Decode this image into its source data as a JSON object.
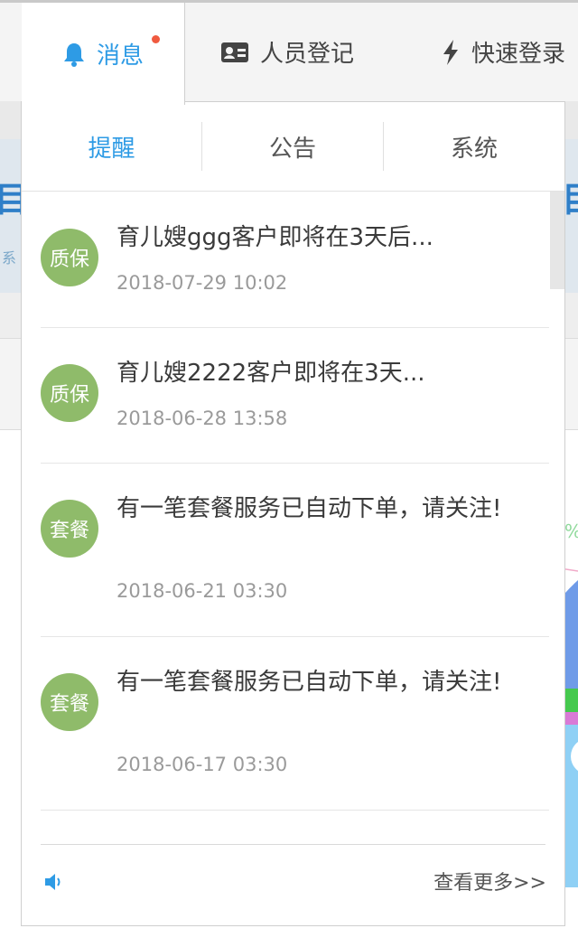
{
  "nav": {
    "messages_label": "消息",
    "registration_label": "人员登记",
    "fast_login_label": "快速登录",
    "unread_dot_color": "#f05a3f",
    "accent_color": "#2e9be5"
  },
  "subtabs": {
    "reminder": "提醒",
    "announcement": "公告",
    "system": "系统",
    "active": "提醒"
  },
  "notifications": [
    {
      "badge": "质保",
      "title": "育儿嫂ggg客户即将在3天后...",
      "time": "2018-07-29 10:02"
    },
    {
      "badge": "质保",
      "title": "育儿嫂2222客户即将在3天...",
      "time": "2018-06-28 13:58"
    },
    {
      "badge": "套餐",
      "title": "有一笔套餐服务已自动下单，请关注!",
      "time": "2018-06-21 03:30"
    },
    {
      "badge": "套餐",
      "title": "有一笔套餐服务已自动下单，请关注!",
      "time": "2018-06-17 03:30"
    }
  ],
  "footer": {
    "more_label": "查看更多>>",
    "speaker_icon": "speaker-icon"
  },
  "background": {
    "left_glyph": "目",
    "left_small": "系",
    "right_glyph": "目",
    "percent": "%"
  },
  "colors": {
    "badge_green": "#8fbb6a",
    "time_gray": "#9a9a9a"
  }
}
